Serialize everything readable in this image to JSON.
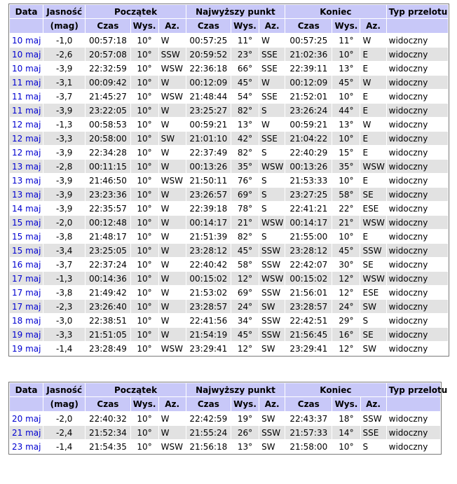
{
  "header": {
    "date": "Data",
    "brightness": "Jasność",
    "brightness_unit": "(mag)",
    "start": "Początek",
    "peak": "Najwyższy punkt",
    "end": "Koniec",
    "type": "Typ przelotu",
    "time": "Czas",
    "alt": "Wys.",
    "az": "Az."
  },
  "table1": [
    {
      "date": "10 maj",
      "mag": "-1,0",
      "s_time": "00:57:18",
      "s_alt": "10°",
      "s_az": "W",
      "p_time": "00:57:25",
      "p_alt": "11°",
      "p_az": "W",
      "e_time": "00:57:25",
      "e_alt": "11°",
      "e_az": "W",
      "type": "widoczny"
    },
    {
      "date": "10 maj",
      "mag": "-2,6",
      "s_time": "20:57:08",
      "s_alt": "10°",
      "s_az": "SSW",
      "p_time": "20:59:52",
      "p_alt": "23°",
      "p_az": "SSE",
      "e_time": "21:02:36",
      "e_alt": "10°",
      "e_az": "E",
      "type": "widoczny"
    },
    {
      "date": "10 maj",
      "mag": "-3,9",
      "s_time": "22:32:59",
      "s_alt": "10°",
      "s_az": "WSW",
      "p_time": "22:36:18",
      "p_alt": "66°",
      "p_az": "SSE",
      "e_time": "22:39:11",
      "e_alt": "13°",
      "e_az": "E",
      "type": "widoczny"
    },
    {
      "date": "11 maj",
      "mag": "-3,1",
      "s_time": "00:09:42",
      "s_alt": "10°",
      "s_az": "W",
      "p_time": "00:12:09",
      "p_alt": "45°",
      "p_az": "W",
      "e_time": "00:12:09",
      "e_alt": "45°",
      "e_az": "W",
      "type": "widoczny"
    },
    {
      "date": "11 maj",
      "mag": "-3,7",
      "s_time": "21:45:27",
      "s_alt": "10°",
      "s_az": "WSW",
      "p_time": "21:48:44",
      "p_alt": "54°",
      "p_az": "SSE",
      "e_time": "21:52:01",
      "e_alt": "10°",
      "e_az": "E",
      "type": "widoczny"
    },
    {
      "date": "11 maj",
      "mag": "-3,9",
      "s_time": "23:22:05",
      "s_alt": "10°",
      "s_az": "W",
      "p_time": "23:25:27",
      "p_alt": "82°",
      "p_az": "S",
      "e_time": "23:26:24",
      "e_alt": "44°",
      "e_az": "E",
      "type": "widoczny"
    },
    {
      "date": "12 maj",
      "mag": "-1,3",
      "s_time": "00:58:53",
      "s_alt": "10°",
      "s_az": "W",
      "p_time": "00:59:21",
      "p_alt": "13°",
      "p_az": "W",
      "e_time": "00:59:21",
      "e_alt": "13°",
      "e_az": "W",
      "type": "widoczny"
    },
    {
      "date": "12 maj",
      "mag": "-3,3",
      "s_time": "20:58:00",
      "s_alt": "10°",
      "s_az": "SW",
      "p_time": "21:01:10",
      "p_alt": "42°",
      "p_az": "SSE",
      "e_time": "21:04:22",
      "e_alt": "10°",
      "e_az": "E",
      "type": "widoczny"
    },
    {
      "date": "12 maj",
      "mag": "-3,9",
      "s_time": "22:34:28",
      "s_alt": "10°",
      "s_az": "W",
      "p_time": "22:37:49",
      "p_alt": "82°",
      "p_az": "S",
      "e_time": "22:40:29",
      "e_alt": "15°",
      "e_az": "E",
      "type": "widoczny"
    },
    {
      "date": "13 maj",
      "mag": "-2,8",
      "s_time": "00:11:15",
      "s_alt": "10°",
      "s_az": "W",
      "p_time": "00:13:26",
      "p_alt": "35°",
      "p_az": "WSW",
      "e_time": "00:13:26",
      "e_alt": "35°",
      "e_az": "WSW",
      "type": "widoczny"
    },
    {
      "date": "13 maj",
      "mag": "-3,9",
      "s_time": "21:46:50",
      "s_alt": "10°",
      "s_az": "WSW",
      "p_time": "21:50:11",
      "p_alt": "76°",
      "p_az": "S",
      "e_time": "21:53:33",
      "e_alt": "10°",
      "e_az": "E",
      "type": "widoczny"
    },
    {
      "date": "13 maj",
      "mag": "-3,9",
      "s_time": "23:23:36",
      "s_alt": "10°",
      "s_az": "W",
      "p_time": "23:26:57",
      "p_alt": "69°",
      "p_az": "S",
      "e_time": "23:27:25",
      "e_alt": "58°",
      "e_az": "SE",
      "type": "widoczny"
    },
    {
      "date": "14 maj",
      "mag": "-3,9",
      "s_time": "22:35:57",
      "s_alt": "10°",
      "s_az": "W",
      "p_time": "22:39:18",
      "p_alt": "78°",
      "p_az": "S",
      "e_time": "22:41:21",
      "e_alt": "22°",
      "e_az": "ESE",
      "type": "widoczny"
    },
    {
      "date": "15 maj",
      "mag": "-2,0",
      "s_time": "00:12:48",
      "s_alt": "10°",
      "s_az": "W",
      "p_time": "00:14:17",
      "p_alt": "21°",
      "p_az": "WSW",
      "e_time": "00:14:17",
      "e_alt": "21°",
      "e_az": "WSW",
      "type": "widoczny"
    },
    {
      "date": "15 maj",
      "mag": "-3,8",
      "s_time": "21:48:17",
      "s_alt": "10°",
      "s_az": "W",
      "p_time": "21:51:39",
      "p_alt": "82°",
      "p_az": "S",
      "e_time": "21:55:00",
      "e_alt": "10°",
      "e_az": "E",
      "type": "widoczny"
    },
    {
      "date": "15 maj",
      "mag": "-3,4",
      "s_time": "23:25:05",
      "s_alt": "10°",
      "s_az": "W",
      "p_time": "23:28:12",
      "p_alt": "45°",
      "p_az": "SSW",
      "e_time": "23:28:12",
      "e_alt": "45°",
      "e_az": "SSW",
      "type": "widoczny"
    },
    {
      "date": "16 maj",
      "mag": "-3,7",
      "s_time": "22:37:24",
      "s_alt": "10°",
      "s_az": "W",
      "p_time": "22:40:42",
      "p_alt": "58°",
      "p_az": "SSW",
      "e_time": "22:42:07",
      "e_alt": "30°",
      "e_az": "SE",
      "type": "widoczny"
    },
    {
      "date": "17 maj",
      "mag": "-1,3",
      "s_time": "00:14:36",
      "s_alt": "10°",
      "s_az": "W",
      "p_time": "00:15:02",
      "p_alt": "12°",
      "p_az": "WSW",
      "e_time": "00:15:02",
      "e_alt": "12°",
      "e_az": "WSW",
      "type": "widoczny"
    },
    {
      "date": "17 maj",
      "mag": "-3,8",
      "s_time": "21:49:42",
      "s_alt": "10°",
      "s_az": "W",
      "p_time": "21:53:02",
      "p_alt": "69°",
      "p_az": "SSW",
      "e_time": "21:56:01",
      "e_alt": "12°",
      "e_az": "ESE",
      "type": "widoczny"
    },
    {
      "date": "17 maj",
      "mag": "-2,3",
      "s_time": "23:26:40",
      "s_alt": "10°",
      "s_az": "W",
      "p_time": "23:28:57",
      "p_alt": "24°",
      "p_az": "SW",
      "e_time": "23:28:57",
      "e_alt": "24°",
      "e_az": "SW",
      "type": "widoczny"
    },
    {
      "date": "18 maj",
      "mag": "-3,0",
      "s_time": "22:38:51",
      "s_alt": "10°",
      "s_az": "W",
      "p_time": "22:41:56",
      "p_alt": "34°",
      "p_az": "SSW",
      "e_time": "22:42:51",
      "e_alt": "29°",
      "e_az": "S",
      "type": "widoczny"
    },
    {
      "date": "19 maj",
      "mag": "-3,3",
      "s_time": "21:51:05",
      "s_alt": "10°",
      "s_az": "W",
      "p_time": "21:54:19",
      "p_alt": "45°",
      "p_az": "SSW",
      "e_time": "21:56:45",
      "e_alt": "16°",
      "e_az": "SE",
      "type": "widoczny"
    },
    {
      "date": "19 maj",
      "mag": "-1,4",
      "s_time": "23:28:49",
      "s_alt": "10°",
      "s_az": "WSW",
      "p_time": "23:29:41",
      "p_alt": "12°",
      "p_az": "SW",
      "e_time": "23:29:41",
      "e_alt": "12°",
      "e_az": "SW",
      "type": "widoczny"
    }
  ],
  "table2": [
    {
      "date": "20 maj",
      "mag": "-2,0",
      "s_time": "22:40:32",
      "s_alt": "10°",
      "s_az": "W",
      "p_time": "22:42:59",
      "p_alt": "19°",
      "p_az": "SW",
      "e_time": "22:43:37",
      "e_alt": "18°",
      "e_az": "SSW",
      "type": "widoczny"
    },
    {
      "date": "21 maj",
      "mag": "-2,4",
      "s_time": "21:52:34",
      "s_alt": "10°",
      "s_az": "W",
      "p_time": "21:55:24",
      "p_alt": "26°",
      "p_az": "SSW",
      "e_time": "21:57:33",
      "e_alt": "14°",
      "e_az": "SSE",
      "type": "widoczny"
    },
    {
      "date": "23 maj",
      "mag": "-1,4",
      "s_time": "21:54:35",
      "s_alt": "10°",
      "s_az": "WSW",
      "p_time": "21:56:18",
      "p_alt": "13°",
      "p_az": "SW",
      "e_time": "21:58:00",
      "e_alt": "10°",
      "e_az": "S",
      "type": "widoczny"
    }
  ]
}
